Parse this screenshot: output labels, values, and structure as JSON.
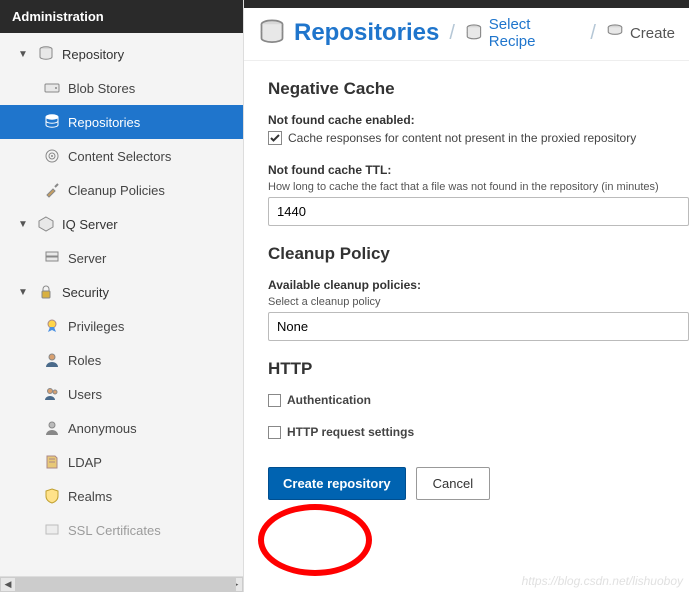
{
  "sidebar": {
    "header": "Administration",
    "groups": [
      {
        "label": "Repository",
        "children": [
          {
            "label": "Blob Stores"
          },
          {
            "label": "Repositories"
          },
          {
            "label": "Content Selectors"
          },
          {
            "label": "Cleanup Policies"
          }
        ]
      },
      {
        "label": "IQ Server",
        "children": [
          {
            "label": "Server"
          }
        ]
      },
      {
        "label": "Security",
        "children": [
          {
            "label": "Privileges"
          },
          {
            "label": "Roles"
          },
          {
            "label": "Users"
          },
          {
            "label": "Anonymous"
          },
          {
            "label": "LDAP"
          },
          {
            "label": "Realms"
          },
          {
            "label": "SSL Certificates"
          }
        ]
      }
    ]
  },
  "breadcrumb": {
    "title": "Repositories",
    "select": "Select Recipe",
    "create": "Create"
  },
  "form": {
    "negcache": {
      "heading": "Negative Cache",
      "enabled_label": "Not found cache enabled:",
      "enabled_text": "Cache responses for content not present in the proxied repository",
      "ttl_label": "Not found cache TTL:",
      "ttl_help": "How long to cache the fact that a file was not found in the repository (in minutes)",
      "ttl_value": "1440"
    },
    "cleanup": {
      "heading": "Cleanup Policy",
      "label": "Available cleanup policies:",
      "help": "Select a cleanup policy",
      "value": "None"
    },
    "http": {
      "heading": "HTTP",
      "auth": "Authentication",
      "req": "HTTP request settings"
    },
    "buttons": {
      "create": "Create repository",
      "cancel": "Cancel"
    }
  },
  "watermark": "https://blog.csdn.net/lishuoboy"
}
